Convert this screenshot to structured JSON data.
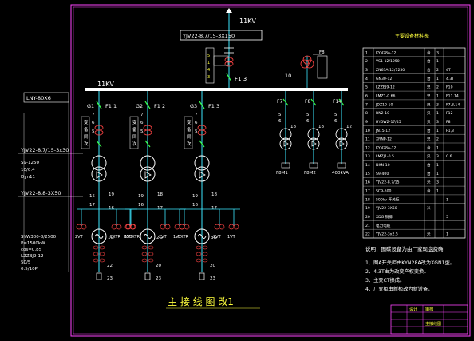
{
  "colors": {
    "background": "#000000",
    "frame": "#ff44ff",
    "bus": "#ffffff",
    "feeder_line": "#3ce8ff",
    "breaker": "#39ff4a",
    "annotation": "#ffff3c",
    "device": "#ff4444"
  },
  "incoming": {
    "voltage": "11KV",
    "cable": "YJV22-8.7/15-3X150",
    "breaker_label": "F1 3"
  },
  "busbar": {
    "label": "11KV"
  },
  "left_panel": {
    "heading": "LNY-80X6",
    "cable_1": "YJV22-8.7/15-3x30",
    "transformer_spec": [
      "S9-1250",
      "10/0.4",
      "Dyn11"
    ],
    "cable_2": "YJV22-8.8-3X50",
    "gen_spec": [
      "SYW300-8/2500",
      "P=1500kW",
      "cos=0.85"
    ],
    "gen_spec_2": [
      "LZZBJ9-12",
      "50/5",
      "0.5/10P"
    ]
  },
  "generator_units": [
    {
      "name": "G1",
      "breaker": "F1 1",
      "numbers": [
        "7",
        "6",
        "5",
        "15",
        "16",
        "17",
        "19",
        "11",
        "16",
        "18",
        "22",
        "23"
      ],
      "cabinet_text": "变 备 同 次",
      "pt_labels": [
        "2VT",
        "EXTR",
        "1VT"
      ],
      "gen_tag": "1G"
    },
    {
      "name": "G2",
      "breaker": "F1 2",
      "numbers": [
        "7",
        "6",
        "5",
        "19",
        "17",
        "16",
        "18",
        "13",
        "22",
        "20",
        "23"
      ],
      "cabinet_text": "变 备 同 次",
      "pt_labels": [
        "2GEXTR",
        "2VT",
        "1VT"
      ],
      "gen_tag": "2G"
    },
    {
      "name": "G3",
      "breaker": "F1 3",
      "numbers": [
        "7",
        "6",
        "5",
        "19",
        "17",
        "16",
        "18",
        "13",
        "22",
        "20",
        "23"
      ],
      "cabinet_text": "变 备 同 次",
      "pt_labels": [
        "EXTR",
        "2VT",
        "1VT"
      ],
      "gen_tag": "3G"
    }
  ],
  "aux_feeders": [
    {
      "breaker": "F7",
      "numbers": [
        "5",
        "6",
        "18"
      ],
      "load": "F8M1"
    },
    {
      "breaker": "F8",
      "numbers": [
        "5",
        "6",
        "18"
      ],
      "load": "F8M2"
    },
    {
      "breaker": "F14",
      "numbers": [
        "5",
        "6",
        "12"
      ],
      "load": "400kVA"
    }
  ],
  "pt_cabinet": {
    "fuse": "F8",
    "number": "10"
  },
  "equipment_table": {
    "title": "主要设备材料表",
    "rows": [
      [
        "1",
        "KYN28A-12",
        "台",
        "3",
        ""
      ],
      [
        "2",
        "VS1-12/1250",
        "台",
        "1",
        ""
      ],
      [
        "3",
        "ZN63A-12/1250",
        "台",
        "2",
        "4T"
      ],
      [
        "4",
        "GN30-12",
        "台",
        "1",
        "4.3T"
      ],
      [
        "5",
        "LZZBJ9-12",
        "只",
        "2",
        "F10"
      ],
      [
        "6",
        "LMZ1-0.66",
        "只",
        "1",
        "F11,14"
      ],
      [
        "7",
        "JDZ10-10",
        "只",
        "3",
        "F7,8,14"
      ],
      [
        "8",
        "RN2-10",
        "只",
        "1",
        "F12"
      ],
      [
        "9",
        "HY5WZ-17/45",
        "只",
        "3",
        "F8"
      ],
      [
        "10",
        "JN15-12",
        "台",
        "1",
        "F1,3"
      ],
      [
        "11",
        "XRNP-12",
        "只",
        "2",
        ""
      ],
      [
        "12",
        "KYN28A-12",
        "台",
        "1",
        ""
      ],
      [
        "13",
        "LMZJ1-0.5",
        "只",
        "3",
        "C 6"
      ],
      [
        "14",
        "DXN-10",
        "台",
        "1",
        ""
      ],
      [
        "15",
        "S9-400",
        "台",
        "1",
        ""
      ],
      [
        "16",
        "YJV22-8.7/15",
        "米",
        "3",
        ""
      ],
      [
        "17",
        "SC9-500",
        "台",
        "1",
        ""
      ],
      [
        "18",
        "500kv 开关柜",
        "",
        "",
        "1"
      ],
      [
        "19",
        "YJV22-3X50",
        "米",
        "",
        ""
      ],
      [
        "20",
        "XDG 铜排",
        "",
        "",
        "5"
      ],
      [
        "21",
        "电力电缆",
        "",
        "",
        ""
      ],
      [
        "22",
        "YJV22-3x2.5",
        "米",
        "",
        "1"
      ]
    ]
  },
  "notes": {
    "heading": "说明：图碳设备为由厂家现盘费确:",
    "items": [
      "1、图A开关柜由KYN28A改为XGN1型。",
      "2、4.3T由为改变产权变换。",
      "3、主变CT换成。",
      "4、厂变柜由新柜改为新设备。"
    ]
  },
  "drawing_title": "主 接 线 图 改1",
  "title_block": {
    "cells": [
      "",
      "设计",
      "审核",
      "",
      "",
      "",
      "主接线图",
      "",
      "",
      ""
    ]
  }
}
